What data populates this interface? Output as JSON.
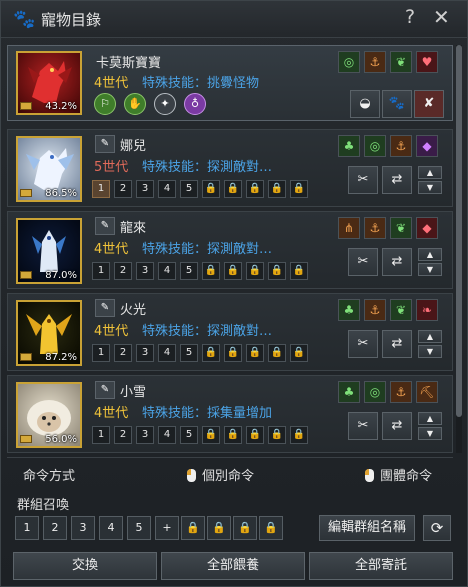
{
  "window": {
    "title": "寵物目錄",
    "help": "?",
    "close": "✕"
  },
  "pets": [
    {
      "name": "卡莫斯寶寶",
      "generation": "4世代",
      "skill": "特殊技能：挑釁怪物",
      "percent": "43.2%"
    },
    {
      "name": "娜兒",
      "generation": "5世代",
      "skill": "特殊技能：探測敵對…",
      "percent": "86.5%"
    },
    {
      "name": "龍來",
      "generation": "4世代",
      "skill": "特殊技能：探測敵對…",
      "percent": "87.0%"
    },
    {
      "name": "火光",
      "generation": "4世代",
      "skill": "特殊技能：探測敵對…",
      "percent": "87.2%"
    },
    {
      "name": "小雪",
      "generation": "4世代",
      "skill": "特殊技能：採集量增加",
      "percent": "56.0%"
    }
  ],
  "slot_numbers": [
    "1",
    "2",
    "3",
    "4",
    "5"
  ],
  "command": {
    "label": "命令方式",
    "individual": "個別命令",
    "group": "團體命令"
  },
  "group_summon": {
    "label": "群組召喚",
    "slots": [
      "1",
      "2",
      "3",
      "4",
      "5",
      "+"
    ],
    "edit_button": "編輯群組名稱"
  },
  "bottom_buttons": {
    "swap": "交換",
    "feed_all": "全部餵養",
    "store_all": "全部寄託"
  },
  "colors": {
    "generation": "#f0c33a",
    "generation_alt": "#e06a5a",
    "skill_text": "#4ba3e6",
    "grade_border": "#c9a235"
  }
}
